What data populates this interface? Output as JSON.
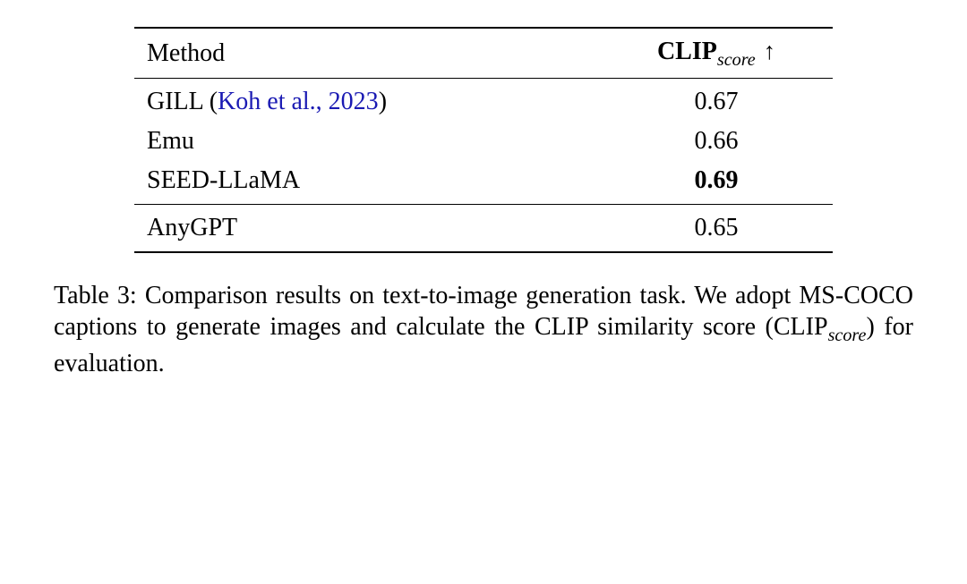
{
  "chart_data": {
    "type": "table",
    "columns": [
      "Method",
      "CLIP_score"
    ],
    "rows": [
      {
        "method": "GILL (Koh et al., 2023)",
        "clip_score": 0.67
      },
      {
        "method": "Emu",
        "clip_score": 0.66
      },
      {
        "method": "SEED-LLaMA",
        "clip_score": 0.69,
        "bold": true
      },
      {
        "method": "AnyGPT",
        "clip_score": 0.65
      }
    ],
    "direction": "higher is better",
    "caption": "Table 3: Comparison results on text-to-image generation task. We adopt MS-COCO captions to generate images and calculate the CLIP similarity score (CLIP_score) for evaluation."
  },
  "header": {
    "method": "Method",
    "clip_prefix": "CLIP",
    "clip_sub": "score",
    "arrow": "↑"
  },
  "rows": {
    "r0": {
      "method_prefix": "GILL  ",
      "cite_open": "(",
      "cite_link": "Koh et al., 2023",
      "cite_close": ")",
      "score": "0.67"
    },
    "r1": {
      "method": "Emu",
      "score": "0.66"
    },
    "r2": {
      "method": "SEED-LLaMA",
      "score": "0.69"
    },
    "r3": {
      "method": "AnyGPT",
      "score": "0.65"
    }
  },
  "caption": {
    "prefix": "Table 3: Comparison results on text-to-image generation task. We adopt MS-COCO captions to generate images and calculate the CLIP similarity score (CLIP",
    "sub": "score",
    "suffix": ") for evaluation."
  }
}
